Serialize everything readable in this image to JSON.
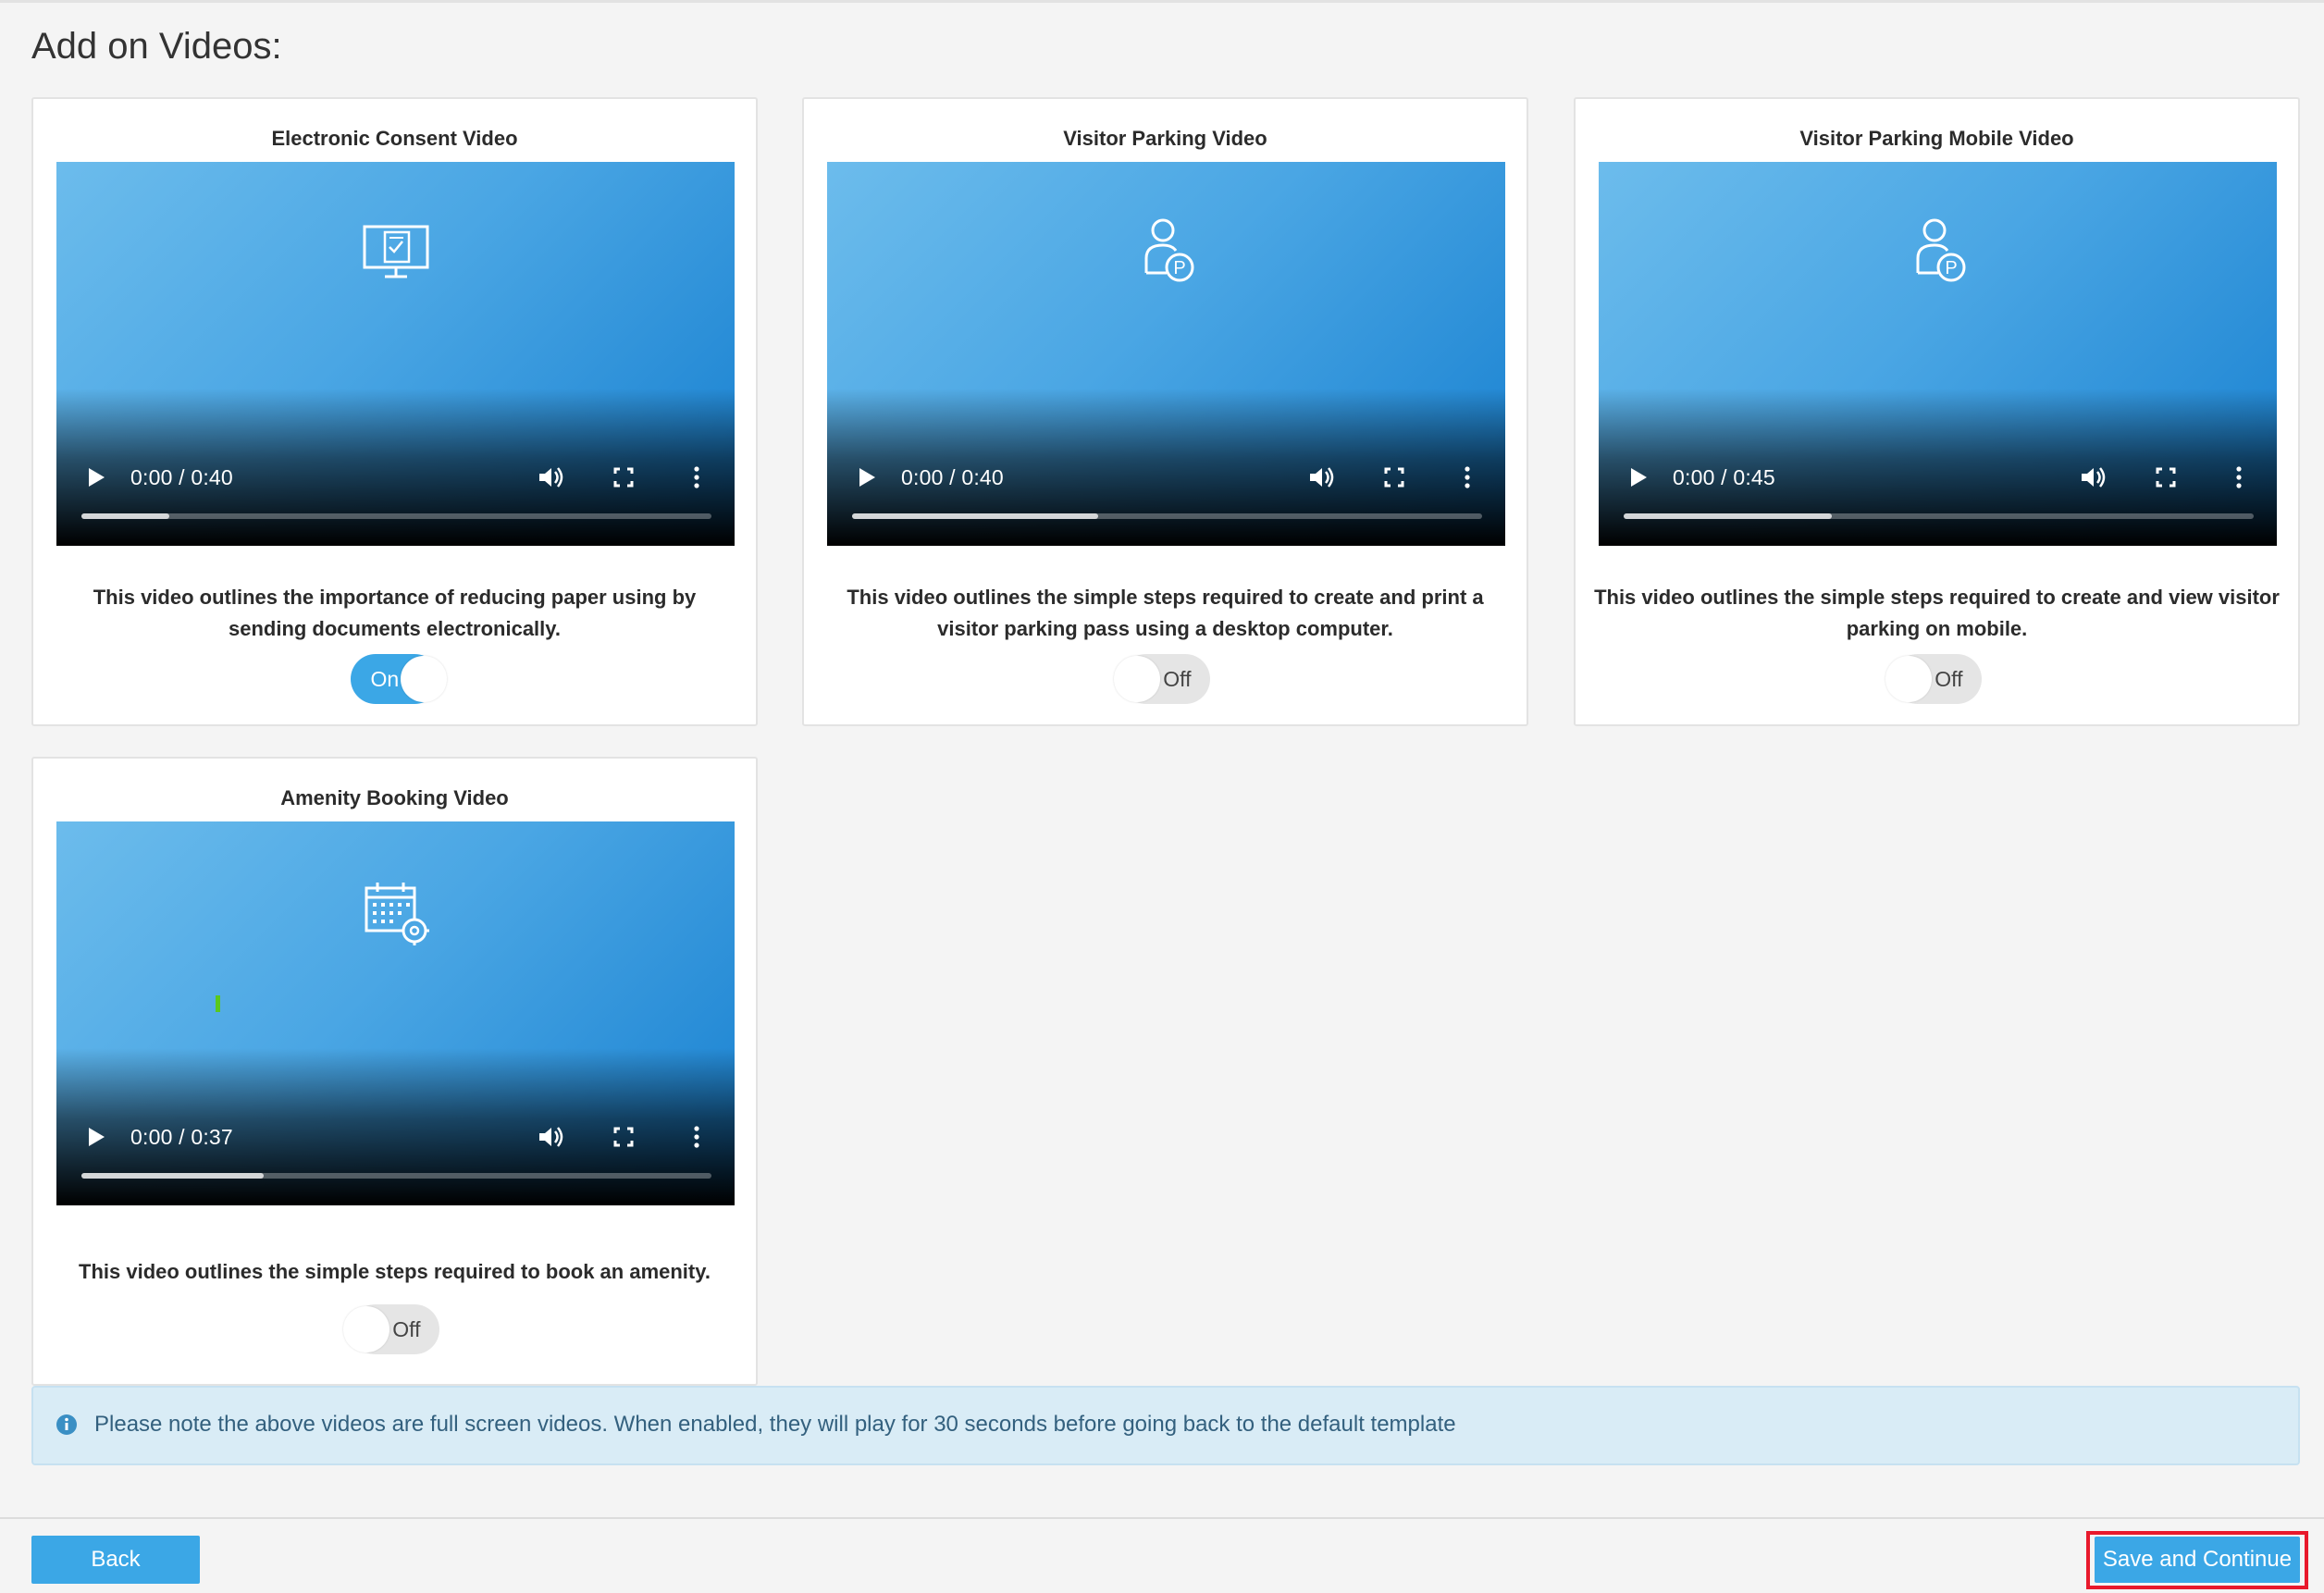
{
  "page": {
    "title": "Add on Videos:"
  },
  "videos": [
    {
      "title": "Electronic Consent Video",
      "time": "0:00 / 0:40",
      "progress": 0.14,
      "icon": "monitor-document-icon",
      "description": "This video outlines the importance of reducing paper using by sending documents electronically.",
      "toggle": {
        "state": true,
        "label": "On"
      }
    },
    {
      "title": "Visitor Parking Video",
      "time": "0:00 / 0:40",
      "progress": 0.39,
      "icon": "person-parking-icon",
      "description": "This video outlines the simple steps required to create and print a visitor parking pass using a desktop computer.",
      "toggle": {
        "state": false,
        "label": "Off"
      }
    },
    {
      "title": "Visitor Parking Mobile Video",
      "time": "0:00 / 0:45",
      "progress": 0.33,
      "icon": "person-parking-icon",
      "description": "This video outlines the simple steps required to create and view visitor parking on mobile.",
      "toggle": {
        "state": false,
        "label": "Off"
      }
    },
    {
      "title": "Amenity Booking Video",
      "time": "0:00 / 0:37",
      "progress": 0.29,
      "icon": "calendar-gear-icon",
      "description": "This video outlines the simple steps required to book an amenity.",
      "toggle": {
        "state": false,
        "label": "Off"
      }
    }
  ],
  "note": {
    "icon": "info-icon",
    "text": "Please note the above videos are full screen videos. When enabled, they will play for 30 seconds before going back to the default template"
  },
  "footer": {
    "back_label": "Back",
    "save_label": "Save and Continue"
  },
  "colors": {
    "accent": "#3ba7e6",
    "highlight_border": "#e8192c",
    "note_bg": "#d9ecf6"
  }
}
